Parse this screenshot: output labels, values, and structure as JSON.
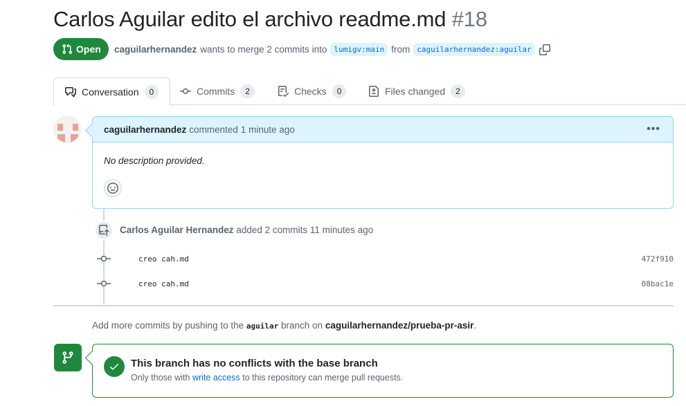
{
  "pr": {
    "title": "Carlos Aguilar edito el archivo readme.md",
    "number": "#18",
    "state": "Open",
    "author": "caguilarhernandez",
    "merge_text": "wants to merge 2 commits into",
    "base_branch": "lumigv:main",
    "from_text": "from",
    "head_branch": "caguilarhernandez:aguilar"
  },
  "tabs": [
    {
      "label": "Conversation",
      "count": "0",
      "icon": "comment-discussion-icon",
      "selected": true
    },
    {
      "label": "Commits",
      "count": "2",
      "icon": "git-commit-icon"
    },
    {
      "label": "Checks",
      "count": "0",
      "icon": "checklist-icon"
    },
    {
      "label": "Files changed",
      "count": "2",
      "icon": "file-diff-icon"
    }
  ],
  "comment": {
    "author": "caguilarhernandez",
    "action": "commented",
    "time": "1 minute ago",
    "body": "No description provided."
  },
  "push_event": {
    "author": "Carlos Aguilar Hernandez",
    "action": "added 2 commits",
    "time": "11 minutes ago"
  },
  "commits": [
    {
      "message": "creo cah.md",
      "sha": "472f910"
    },
    {
      "message": "creo cah.md",
      "sha": "08bac1e"
    }
  ],
  "hint": {
    "prefix": "Add more commits by pushing to the",
    "branch": "aguilar",
    "middle": "branch on",
    "repo": "caguilarhernandez/prueba-pr-asir",
    "suffix": "."
  },
  "merge": {
    "title": "This branch has no conflicts with the base branch",
    "sub_prefix": "Only those with",
    "sub_link": "write access",
    "sub_suffix": "to this repository can merge pull requests."
  },
  "colors": {
    "open_green": "#1f883d",
    "link_blue": "#0969da",
    "comment_header_bg": "#ddf4ff",
    "comment_border": "#9bd0f5"
  }
}
